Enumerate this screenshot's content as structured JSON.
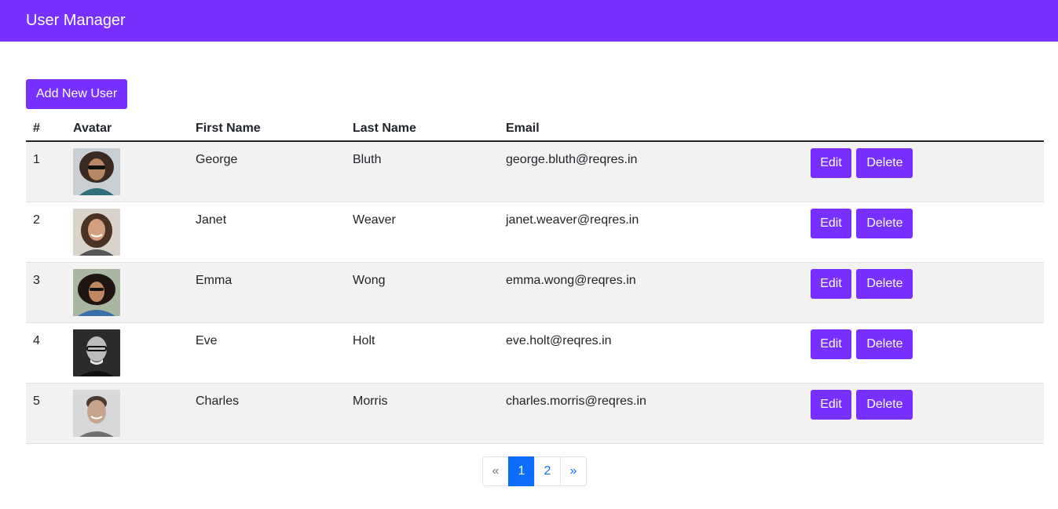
{
  "navbar": {
    "title": "User Manager"
  },
  "actions": {
    "add_label": "Add New User"
  },
  "table": {
    "headers": {
      "num": "#",
      "avatar": "Avatar",
      "first": "First Name",
      "last": "Last Name",
      "email": "Email"
    },
    "rows": [
      {
        "id": "1",
        "first": "George",
        "last": "Bluth",
        "email": "george.bluth@reqres.in",
        "edit": "Edit",
        "delete": "Delete"
      },
      {
        "id": "2",
        "first": "Janet",
        "last": "Weaver",
        "email": "janet.weaver@reqres.in",
        "edit": "Edit",
        "delete": "Delete"
      },
      {
        "id": "3",
        "first": "Emma",
        "last": "Wong",
        "email": "emma.wong@reqres.in",
        "edit": "Edit",
        "delete": "Delete"
      },
      {
        "id": "4",
        "first": "Eve",
        "last": "Holt",
        "email": "eve.holt@reqres.in",
        "edit": "Edit",
        "delete": "Delete"
      },
      {
        "id": "5",
        "first": "Charles",
        "last": "Morris",
        "email": "charles.morris@reqres.in",
        "edit": "Edit",
        "delete": "Delete"
      }
    ]
  },
  "pagination": {
    "prev": "«",
    "pages": [
      "1",
      "2"
    ],
    "next": "»",
    "active_page": "1"
  },
  "colors": {
    "accent": "#7730ff",
    "page_active": "#0d6efd"
  }
}
